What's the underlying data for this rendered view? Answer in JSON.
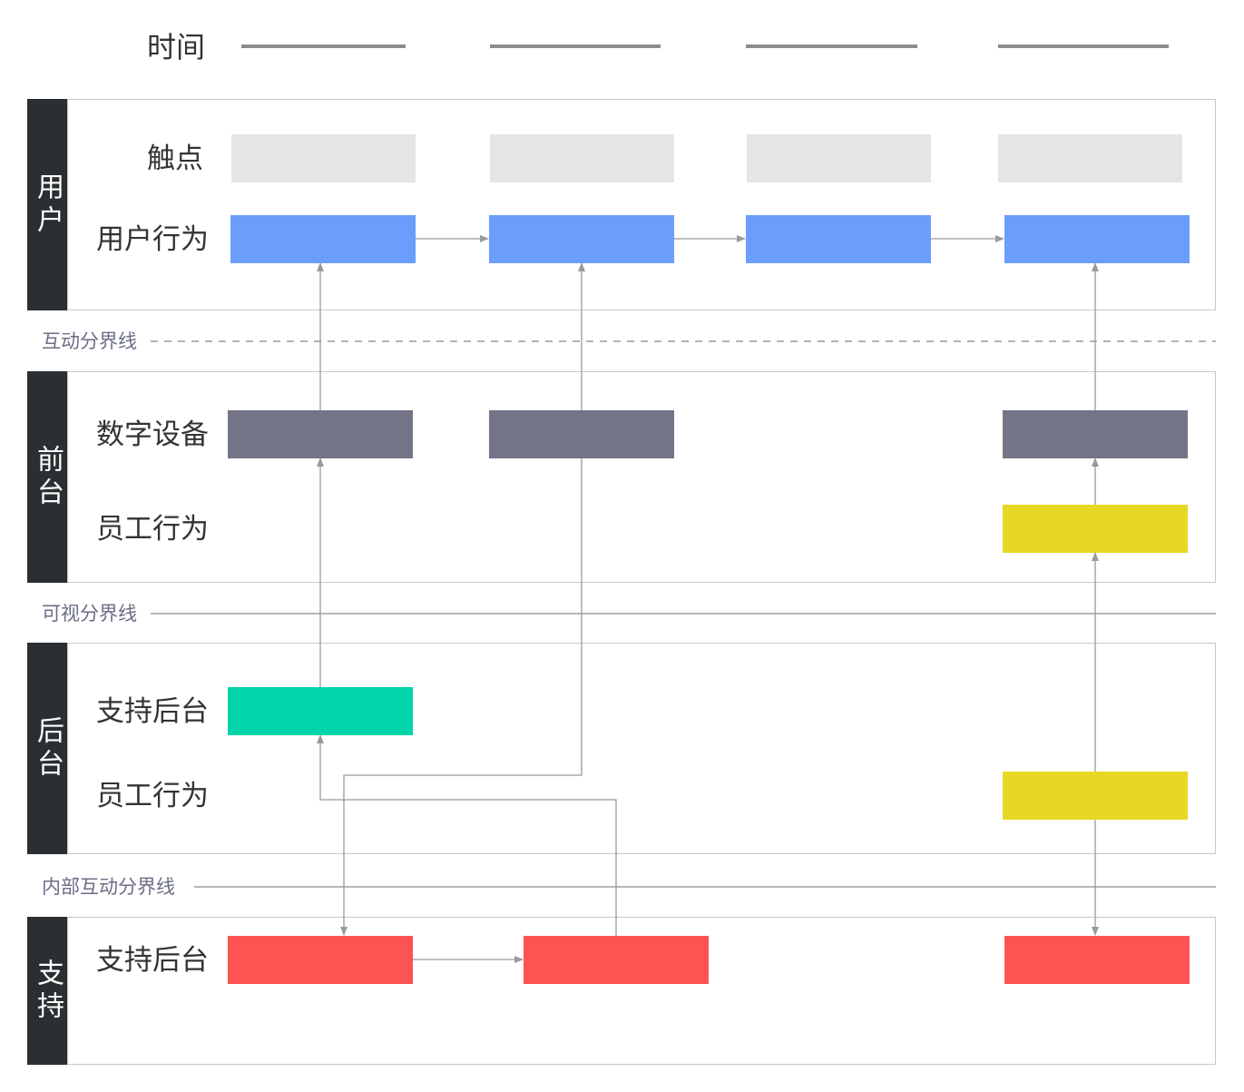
{
  "header": {
    "time_label": "时间"
  },
  "lanes": {
    "user": {
      "side": "用户",
      "touchpoint": "触点",
      "behavior": "用户行为"
    },
    "front": {
      "side": "前台",
      "device": "数字设备",
      "staff": "员工行为"
    },
    "back": {
      "side": "后台",
      "support": "支持后台",
      "staff": "员工行为"
    },
    "support": {
      "side": "支持",
      "support": "支持后台"
    }
  },
  "dividers": {
    "interaction": "互动分界线",
    "visibility": "可视分界线",
    "internal": "内部互动分界线"
  },
  "colors": {
    "touchpoint": "#e5e5e5",
    "user_action": "#6b9dfd",
    "device": "#737488",
    "staff": "#e8d724",
    "backstage": "#00d4a8",
    "support": "#fd5353",
    "side_bar": "#2b2f31",
    "connector": "#9a9a9a"
  }
}
